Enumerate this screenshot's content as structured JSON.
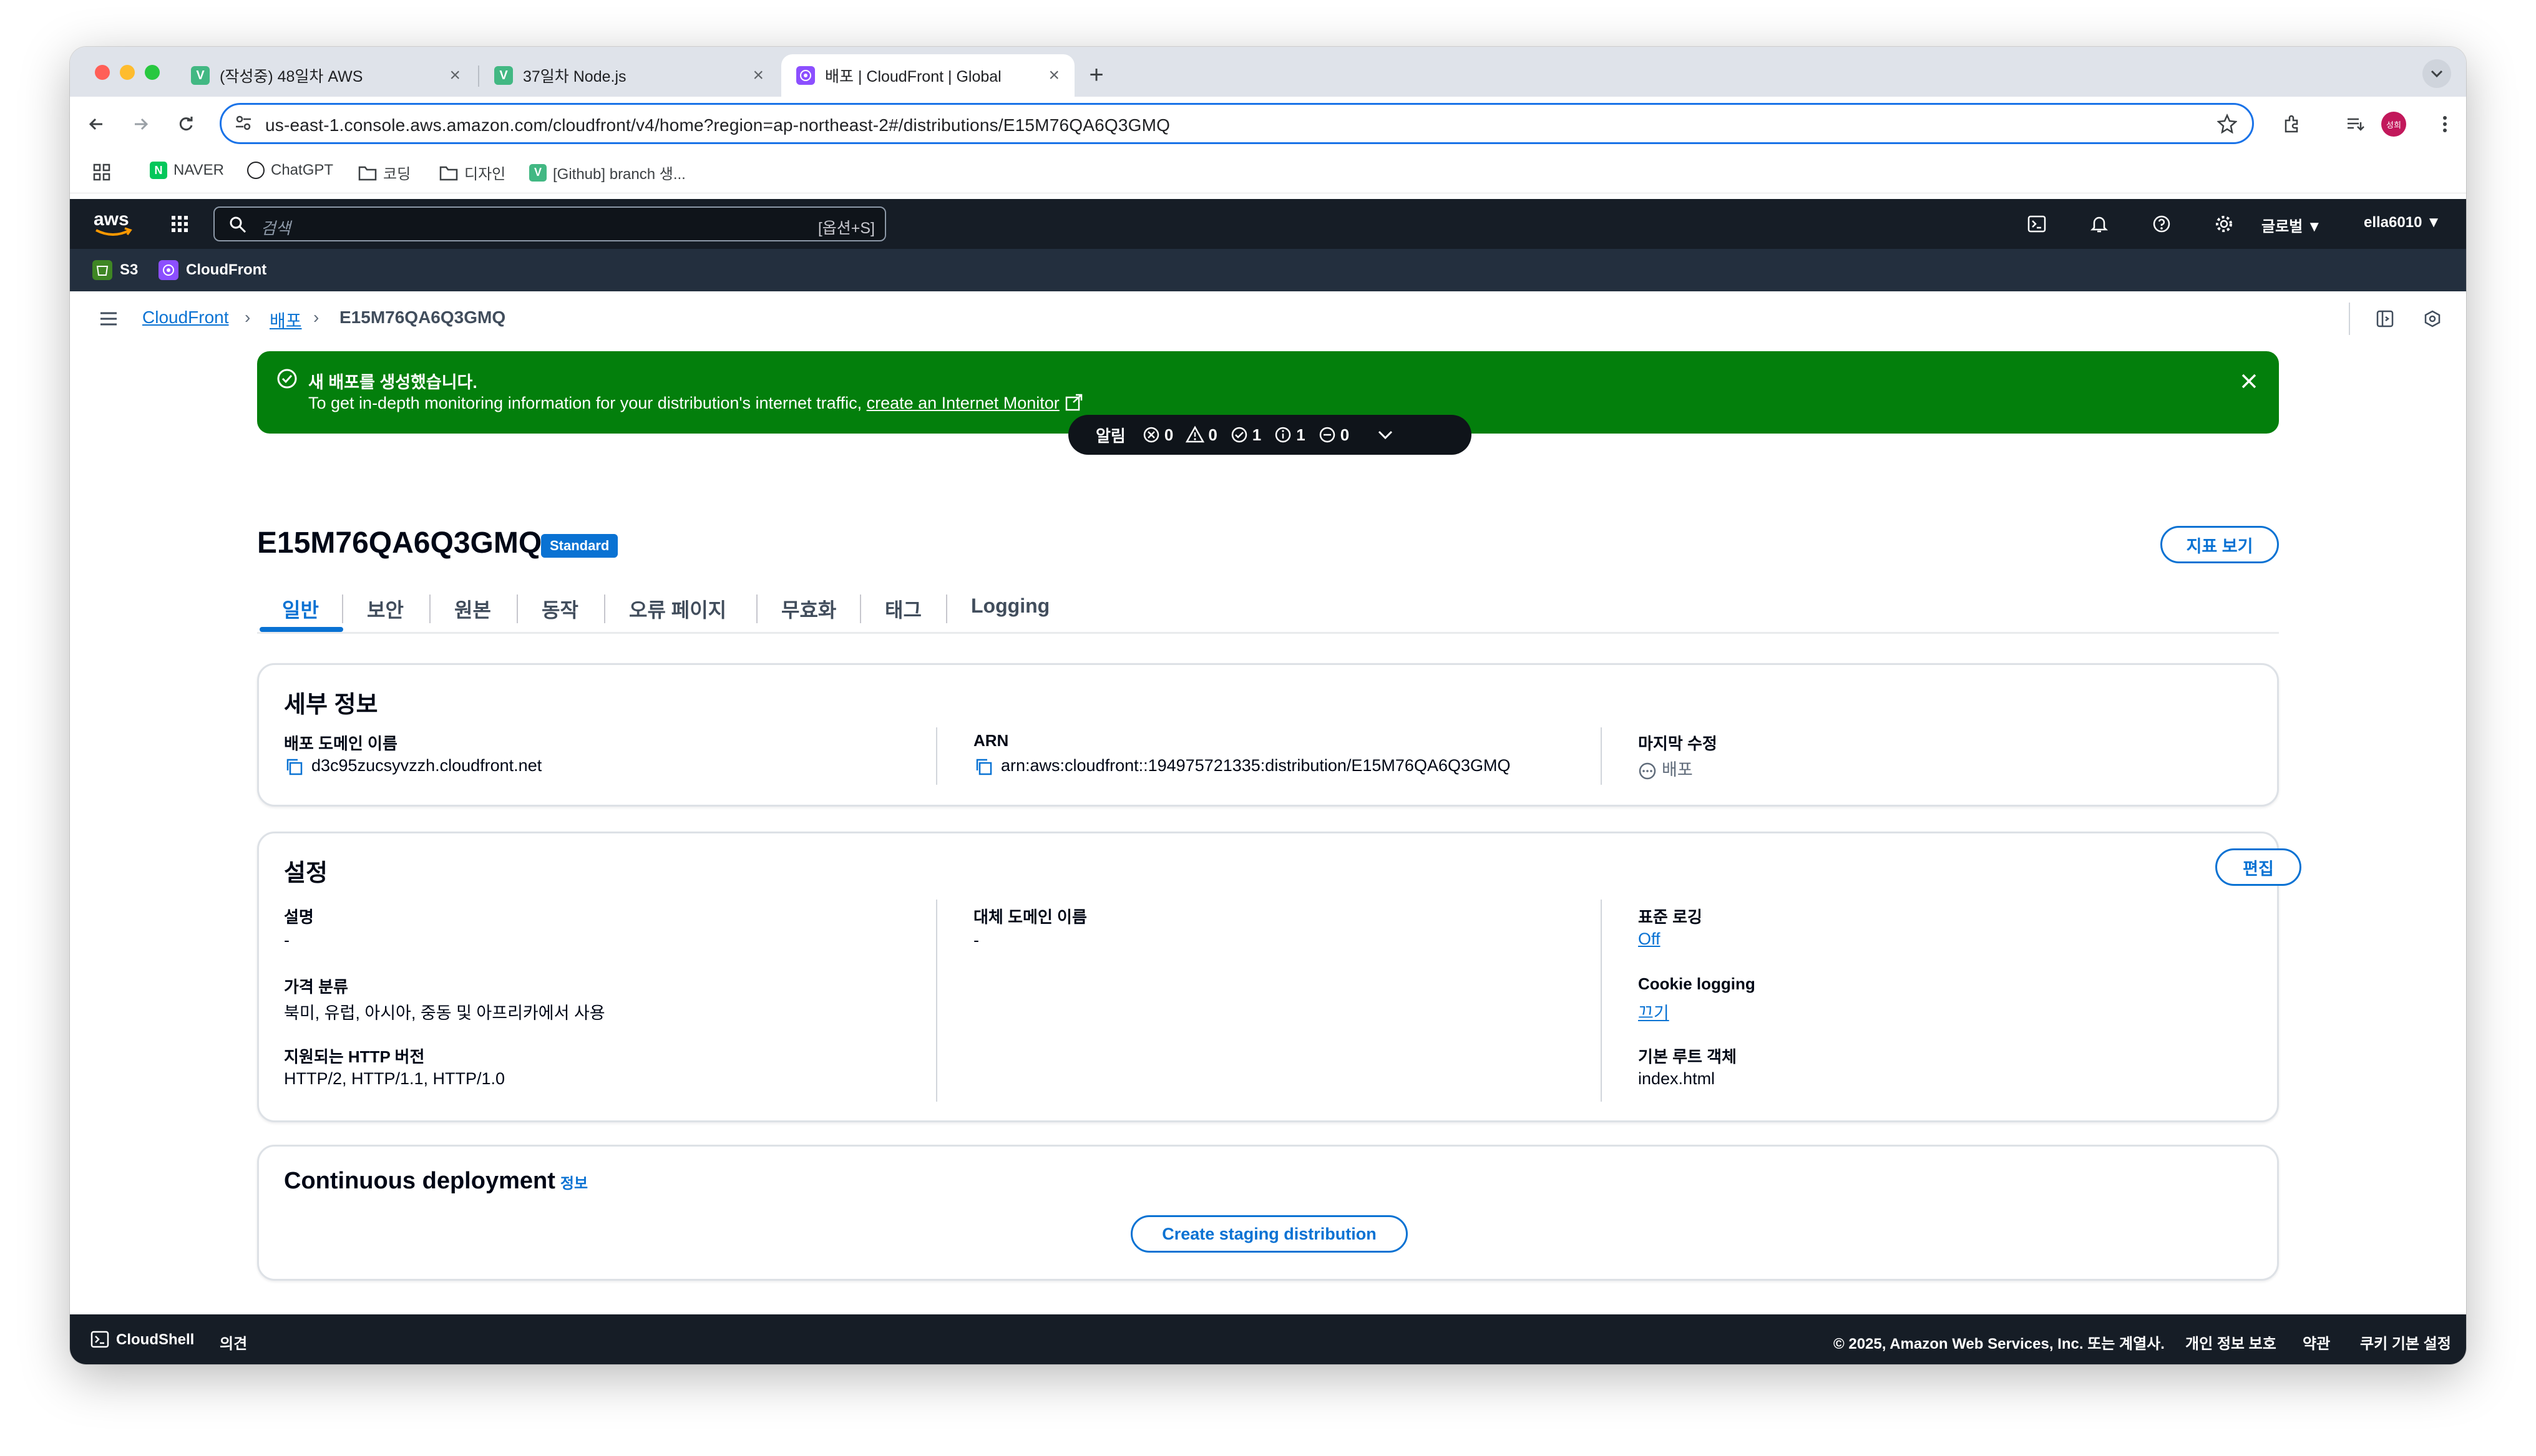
{
  "browser": {
    "tabs": [
      {
        "title": "(작성중) 48일차 AWS",
        "favicon": "V"
      },
      {
        "title": "37일차 Node.js",
        "favicon": "V"
      },
      {
        "title": "배포 | CloudFront | Global",
        "favicon": "CF"
      }
    ],
    "url": "us-east-1.console.aws.amazon.com/cloudfront/v4/home?region=ap-northeast-2#/distributions/E15M76QA6Q3GMQ",
    "avatar_label": "성희",
    "bookmarks": [
      {
        "label": "NAVER"
      },
      {
        "label": "ChatGPT"
      },
      {
        "label": "코딩"
      },
      {
        "label": "디자인"
      },
      {
        "label": "[Github] branch 생..."
      }
    ]
  },
  "aws": {
    "search_placeholder": "검색",
    "search_shortcut": "[옵션+S]",
    "region": "글로벌 ▼",
    "user": "ella6010 ▼",
    "services": [
      {
        "label": "S3"
      },
      {
        "label": "CloudFront"
      }
    ]
  },
  "breadcrumb": {
    "items": [
      "CloudFront",
      "배포"
    ],
    "current": "E15M76QA6Q3GMQ"
  },
  "flash": {
    "title": "새 배포를 생성했습니다.",
    "message": "To get in-depth monitoring information for your distribution's internet traffic, ",
    "link": "create an Internet Monitor"
  },
  "notifications": {
    "label": "알림",
    "error": "0",
    "warning": "0",
    "success": "1",
    "info": "1",
    "pending": "0"
  },
  "distribution": {
    "id": "E15M76QA6Q3GMQ",
    "badge": "Standard",
    "metrics_button": "지표 보기"
  },
  "tabs": [
    "일반",
    "보안",
    "원본",
    "동작",
    "오류 페이지",
    "무효화",
    "태그",
    "Logging"
  ],
  "details": {
    "heading": "세부 정보",
    "domain_label": "배포 도메인 이름",
    "domain_value": "d3c95zucsyvzzh.cloudfront.net",
    "arn_label": "ARN",
    "arn_value": "arn:aws:cloudfront::194975721335:distribution/E15M76QA6Q3GMQ",
    "modified_label": "마지막 수정",
    "modified_value": "배포"
  },
  "settings": {
    "heading": "설정",
    "edit_button": "편집",
    "description_label": "설명",
    "description_value": "-",
    "price_label": "가격 분류",
    "price_value": "북미, 유럽, 아시아, 중동 및 아프리카에서 사용",
    "http_label": "지원되는 HTTP 버전",
    "http_value": "HTTP/2, HTTP/1.1, HTTP/1.0",
    "alt_domain_label": "대체 도메인 이름",
    "alt_domain_value": "-",
    "std_logging_label": "표준 로깅",
    "std_logging_value": "Off",
    "cookie_label": "Cookie logging",
    "cookie_value": "끄기",
    "root_label": "기본 루트 객체",
    "root_value": "index.html"
  },
  "continuous": {
    "heading": "Continuous deployment",
    "info_link": "정보",
    "button": "Create staging distribution"
  },
  "footer": {
    "cloudshell": "CloudShell",
    "feedback": "의견",
    "copyright": "© 2025, Amazon Web Services, Inc. 또는 계열사.",
    "privacy": "개인 정보 보호",
    "terms": "약관",
    "cookie": "쿠키 기본 설정"
  },
  "colors": {
    "aws_nav": "#161d26",
    "success_green": "#037f0c",
    "link_blue": "#0972d3",
    "chrome_focus": "#1a73e8"
  }
}
